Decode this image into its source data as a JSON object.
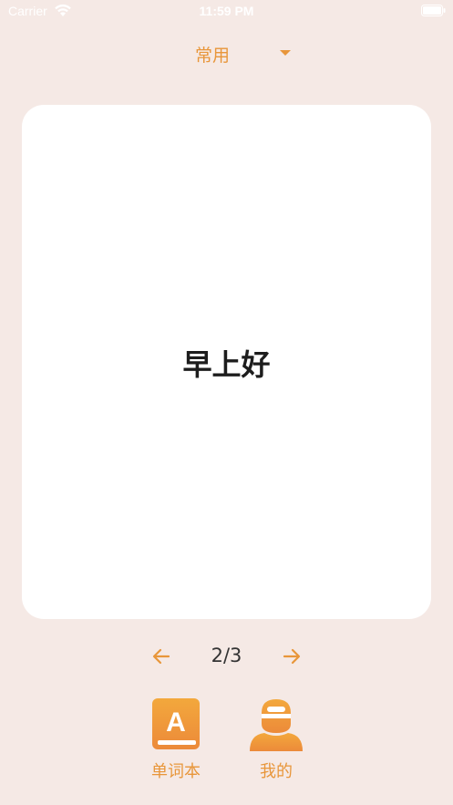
{
  "status_bar": {
    "carrier": "Carrier",
    "time": "11:59 PM"
  },
  "category": {
    "selected": "常用"
  },
  "card": {
    "word": "早上好"
  },
  "pager": {
    "current": "2/3"
  },
  "tabs": [
    {
      "label": "单词本",
      "icon": "vocabulary-book-icon"
    },
    {
      "label": "我的",
      "icon": "user-profile-icon"
    }
  ],
  "colors": {
    "background": "#f5e9e5",
    "accent": "#e8963a",
    "card": "#ffffff",
    "text": "#1d1d1d"
  }
}
